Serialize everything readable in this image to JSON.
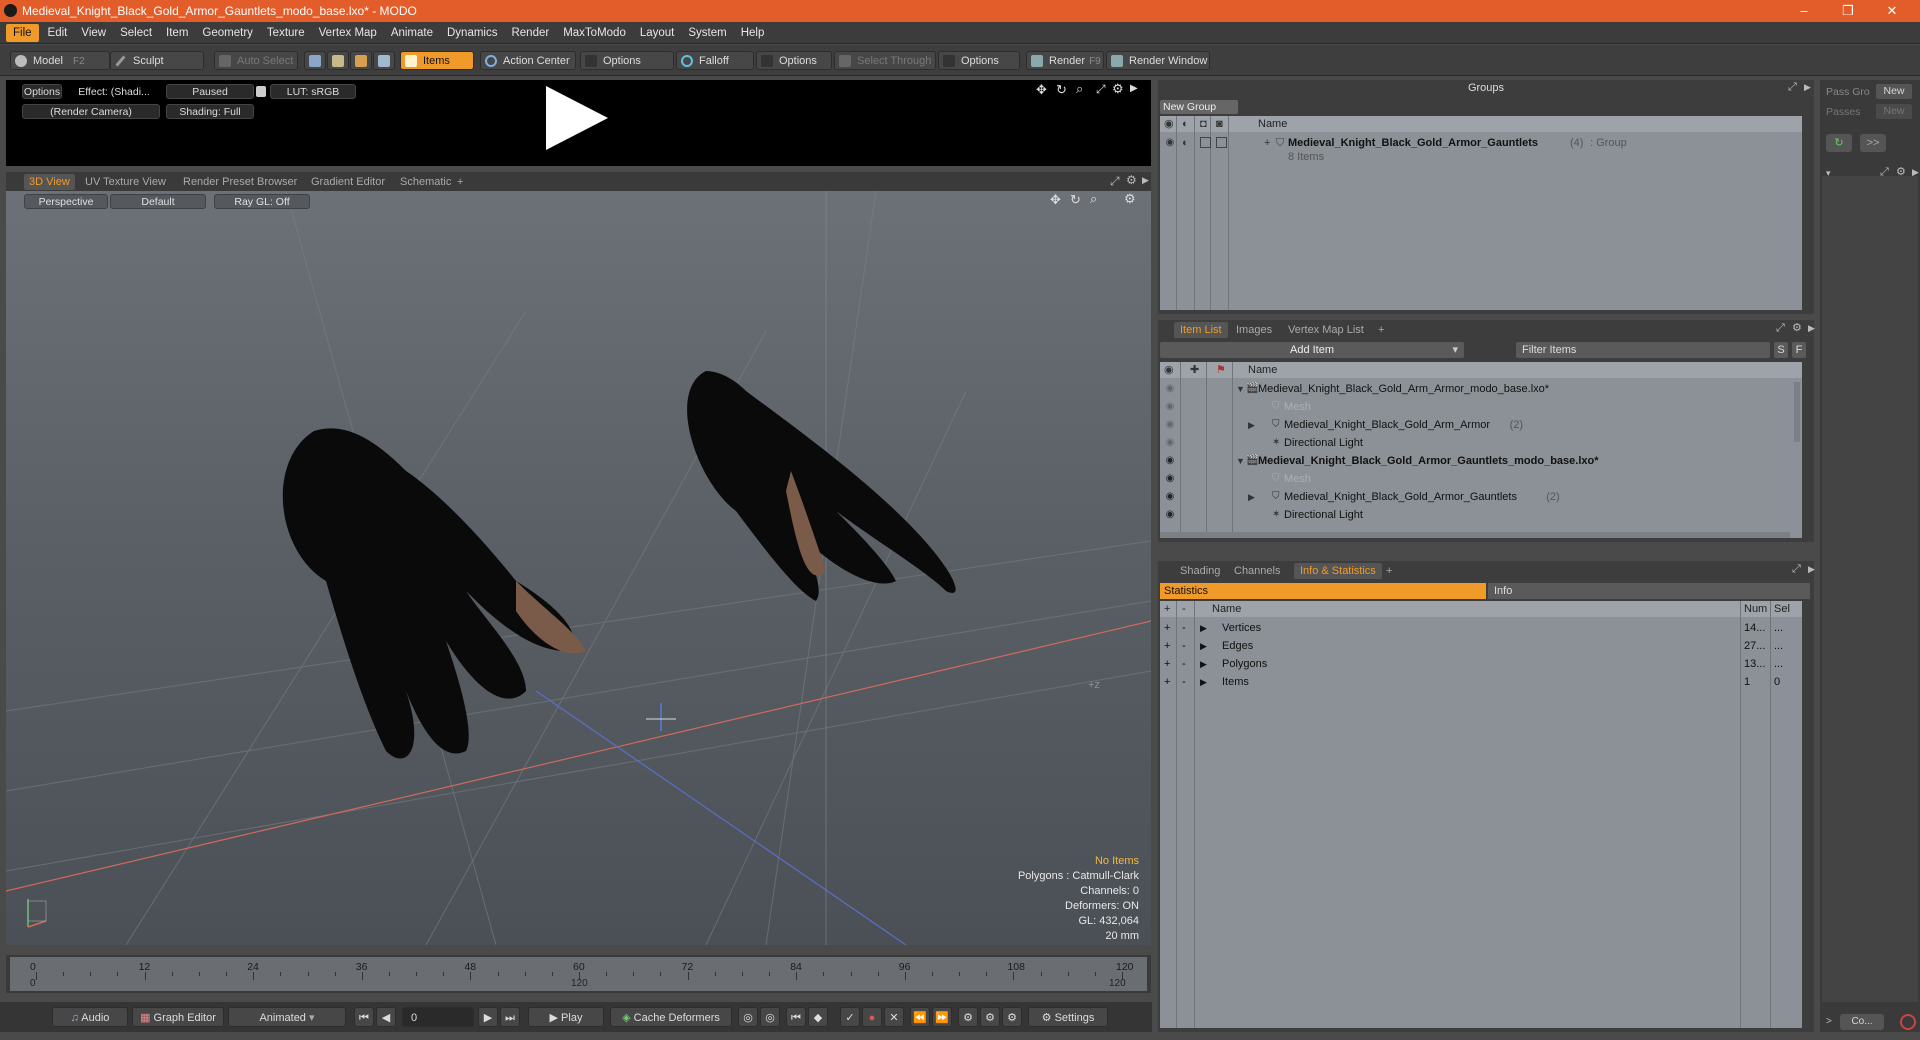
{
  "window": {
    "title": "Medieval_Knight_Black_Gold_Armor_Gauntlets_modo_base.lxo* - MODO",
    "minimize": "–",
    "maximize": "❐",
    "close": "✕"
  },
  "menu": [
    "File",
    "Edit",
    "View",
    "Select",
    "Item",
    "Geometry",
    "Texture",
    "Vertex Map",
    "Animate",
    "Dynamics",
    "Render",
    "MaxToModo",
    "Layout",
    "System",
    "Help"
  ],
  "toolbar": {
    "model": "Model",
    "model_key": "F2",
    "sculpt": "Sculpt",
    "auto_select": "Auto Select",
    "items": "Items",
    "action_center": "Action Center",
    "options1": "Options",
    "falloff": "Falloff",
    "options2": "Options",
    "select_through": "Select Through",
    "options3": "Options",
    "render": "Render",
    "render_key": "F9",
    "render_window": "Render Window"
  },
  "preview": {
    "options": "Options",
    "effect": "Effect: (Shadi...",
    "paused": "Paused",
    "lut": "LUT: sRGB",
    "camera": "(Render Camera)",
    "shading": "Shading: Full"
  },
  "viewport_tabs": [
    "3D View",
    "UV Texture View",
    "Render Preset Browser",
    "Gradient Editor",
    "Schematic",
    "+"
  ],
  "viewport": {
    "perspective": "Perspective",
    "default": "Default",
    "raygl": "Ray GL: Off",
    "stats": {
      "no_items": "No Items",
      "polygons": "Polygons : Catmull-Clark",
      "channels": "Channels: 0",
      "deformers": "Deformers: ON",
      "gl": "GL: 432,064",
      "unit": "20 mm"
    }
  },
  "timeline": {
    "ticks": [
      "0",
      "12",
      "24",
      "36",
      "48",
      "60",
      "72",
      "84",
      "96",
      "108",
      "120"
    ],
    "start": "0",
    "mid": "120",
    "end": "120"
  },
  "bottom": {
    "audio": "Audio",
    "graph_editor": "Graph Editor",
    "animated": "Animated",
    "frame": "0",
    "play": "Play",
    "cache": "Cache Deformers",
    "settings": "Settings"
  },
  "groups": {
    "title": "Groups",
    "new_group": "New Group",
    "col_name": "Name",
    "item_name": "Medieval_Knight_Black_Gold_Armor_Gauntlets",
    "item_count": "(4)",
    "item_type": ": Group",
    "item_sub": "8 Items"
  },
  "side": {
    "pass_group": "Pass Gro",
    "new1": "New",
    "passes": "Passes",
    "new2": "New",
    "arrows": ">>",
    "co": "Co..."
  },
  "itemlist": {
    "tabs": [
      "Item List",
      "Images",
      "Vertex Map List",
      "+"
    ],
    "add_item": "Add Item",
    "filter": "Filter Items",
    "s": "S",
    "f": "F",
    "col_name": "Name",
    "rows": [
      {
        "text": "Medieval_Knight_Black_Gold_Arm_Armor_modo_base.lxo*",
        "indent": 0,
        "style": "scene"
      },
      {
        "text": "Mesh",
        "indent": 1,
        "style": "grey"
      },
      {
        "text": "Medieval_Knight_Black_Gold_Arm_Armor",
        "count": "(2)",
        "indent": 1,
        "style": "normal"
      },
      {
        "text": "Directional Light",
        "indent": 1,
        "style": "normal"
      },
      {
        "text": "Medieval_Knight_Black_Gold_Armor_Gauntlets_modo_base.lxo*",
        "indent": 0,
        "style": "scenebold"
      },
      {
        "text": "Mesh",
        "indent": 1,
        "style": "grey"
      },
      {
        "text": "Medieval_Knight_Black_Gold_Armor_Gauntlets",
        "count": "(2)",
        "indent": 1,
        "style": "normal"
      },
      {
        "text": "Directional Light",
        "indent": 1,
        "style": "normal"
      }
    ]
  },
  "info": {
    "tabs": [
      "Shading",
      "Channels",
      "Info & Statistics",
      "+"
    ],
    "statistics": "Statistics",
    "info": "Info",
    "col_name": "Name",
    "col_num": "Num",
    "col_sel": "Sel",
    "rows": [
      {
        "name": "Vertices",
        "num": "14...",
        "sel": "..."
      },
      {
        "name": "Edges",
        "num": "27...",
        "sel": "..."
      },
      {
        "name": "Polygons",
        "num": "13...",
        "sel": "..."
      },
      {
        "name": "Items",
        "num": "1",
        "sel": "0"
      }
    ]
  }
}
